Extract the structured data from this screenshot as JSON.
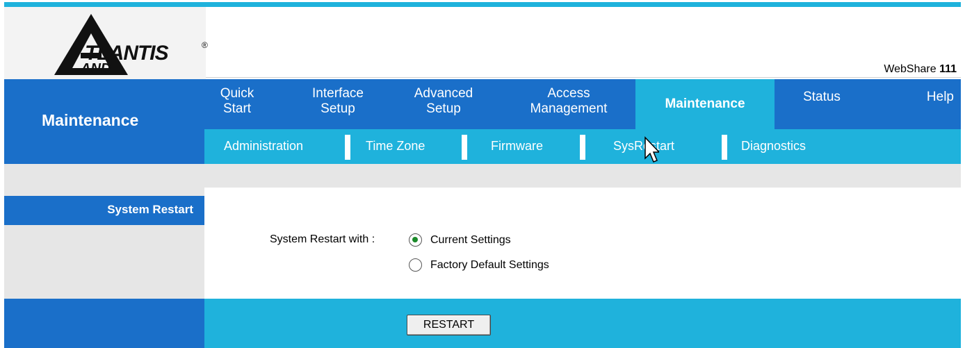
{
  "brand": {
    "logo_text_top": "TLANTIS",
    "logo_text_bottom": "AND",
    "logo_reg": "®"
  },
  "header": {
    "model_prefix": "WebShare ",
    "model_number": "111"
  },
  "section": {
    "title": "Maintenance"
  },
  "tabs": [
    {
      "line1": "Quick",
      "line2": "Start"
    },
    {
      "line1": "Interface",
      "line2": "Setup"
    },
    {
      "line1": "Advanced",
      "line2": "Setup"
    },
    {
      "line1": "Access",
      "line2": "Management"
    },
    {
      "label": "Maintenance",
      "active": true
    },
    {
      "label": "Status"
    },
    {
      "label": "Help"
    }
  ],
  "subnav": [
    "Administration",
    "Time Zone",
    "Firmware",
    "SysRestart",
    "Diagnostics"
  ],
  "left_panel": {
    "heading": "System Restart"
  },
  "form": {
    "label": "System Restart with :",
    "options": [
      {
        "label": "Current Settings",
        "checked": true
      },
      {
        "label": "Factory Default Settings",
        "checked": false
      }
    ],
    "button": "RESTART"
  },
  "colors": {
    "primary_blue": "#1a6fc9",
    "accent_cyan": "#1fb2dc",
    "panel_grey": "#e6e6e6"
  }
}
